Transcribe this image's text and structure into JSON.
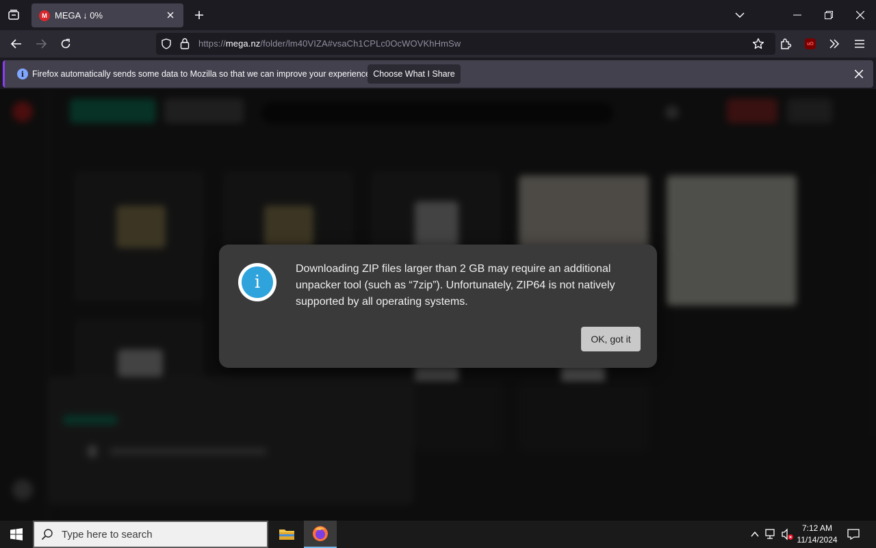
{
  "browser": {
    "tab_title": "MEGA ↓ 0%",
    "tab_favicon": "M",
    "url_prefix": "https://",
    "url_host": "mega.nz",
    "url_path": "/folder/lm40VIZA#vsaCh1CPLc0OcWOVKhHmSw",
    "notification": {
      "message": "Firefox automatically sends some data to Mozilla so that we can improve your experience.",
      "button": "Choose What I Share"
    }
  },
  "dialog": {
    "message": "Downloading ZIP files larger than 2 GB may require an additional unpacker tool (such as “7zip”). Unfortunately, ZIP64 is not natively supported by all operating systems.",
    "ok_button": "OK, got it",
    "icon": "info-icon"
  },
  "taskbar": {
    "search_placeholder": "Type here to search",
    "time": "7:12 AM",
    "date": "11/14/2024"
  },
  "colors": {
    "accent_purple": "#8a3ff3",
    "mega_red": "#d9272e",
    "info_blue": "#2ea3dc"
  }
}
